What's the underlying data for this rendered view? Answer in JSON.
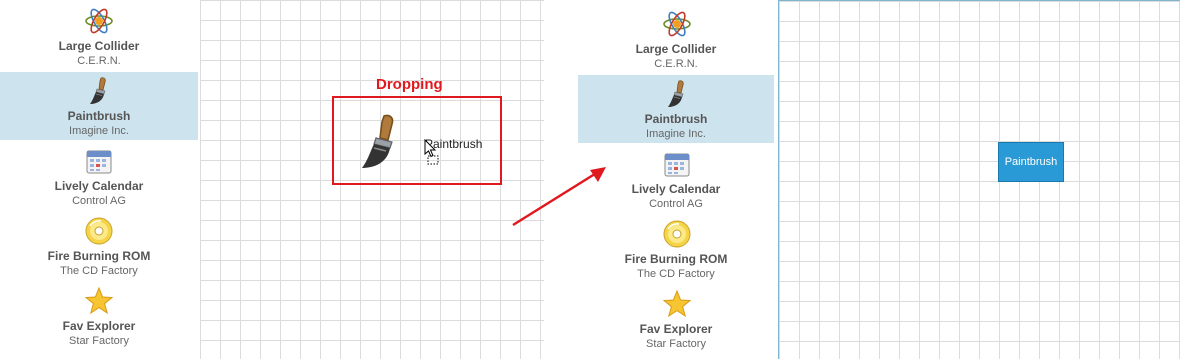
{
  "palette_items": [
    {
      "title": "Large Collider",
      "subtitle": "C.E.R.N.",
      "icon": "atom-icon"
    },
    {
      "title": "Paintbrush",
      "subtitle": "Imagine Inc.",
      "icon": "paintbrush-icon"
    },
    {
      "title": "Lively Calendar",
      "subtitle": "Control AG",
      "icon": "calendar-icon"
    },
    {
      "title": "Fire Burning ROM",
      "subtitle": "The CD Factory",
      "icon": "cd-icon"
    },
    {
      "title": "Fav Explorer",
      "subtitle": "Star Factory",
      "icon": "star-icon"
    }
  ],
  "selected_item": "Paintbrush",
  "drop_annotation": {
    "caption": "Dropping",
    "drag_label": "Paintbrush"
  },
  "placed_node": {
    "label": "Paintbrush"
  },
  "colors": {
    "selection": "#cde3ee",
    "annotation": "#e0191f",
    "node_fill": "#2a9ad6",
    "grid_line": "#dcdcdc"
  }
}
